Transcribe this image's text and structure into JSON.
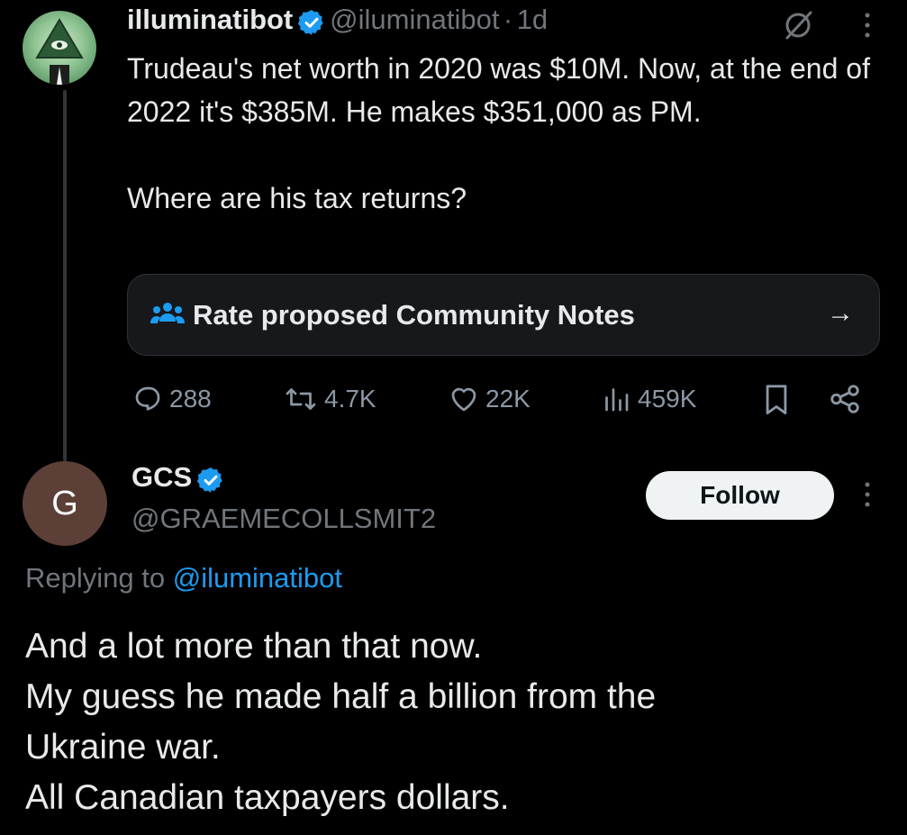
{
  "tweet": {
    "author_name": "illuminatibot",
    "author_handle": "@iluminatibot",
    "separator": "·",
    "time": "1d",
    "text": "Trudeau's net worth in 2020 was $10M. Now, at the end of 2022 it's $385M. He makes $351,000 as PM.\n\nWhere are his tax returns?",
    "community_note": {
      "label": "Rate proposed Community Notes",
      "arrow": "→"
    },
    "actions": {
      "replies": "288",
      "reposts": "4.7K",
      "likes": "22K",
      "views": "459K"
    }
  },
  "reply": {
    "avatar_letter": "G",
    "author_name": "GCS",
    "author_handle": "@GRAEMECOLLSMIT2",
    "follow_label": "Follow",
    "replying_prefix": "Replying to",
    "replying_handle": "@iluminatibot",
    "text": "And a lot more than that now.\nMy guess he made half a billion from the\nUkraine war.\nAll Canadian taxpayers dollars."
  },
  "colors": {
    "background": "#000000",
    "text": "#e7e9ea",
    "muted": "#71767b",
    "accent": "#1d9bf0",
    "verified": "#1d9bf0"
  },
  "icons": [
    "verified-badge-icon",
    "grok-icon",
    "more-icon",
    "community-people-icon",
    "arrow-right-icon",
    "reply-icon",
    "repost-icon",
    "like-icon",
    "views-icon",
    "bookmark-icon",
    "share-icon"
  ]
}
